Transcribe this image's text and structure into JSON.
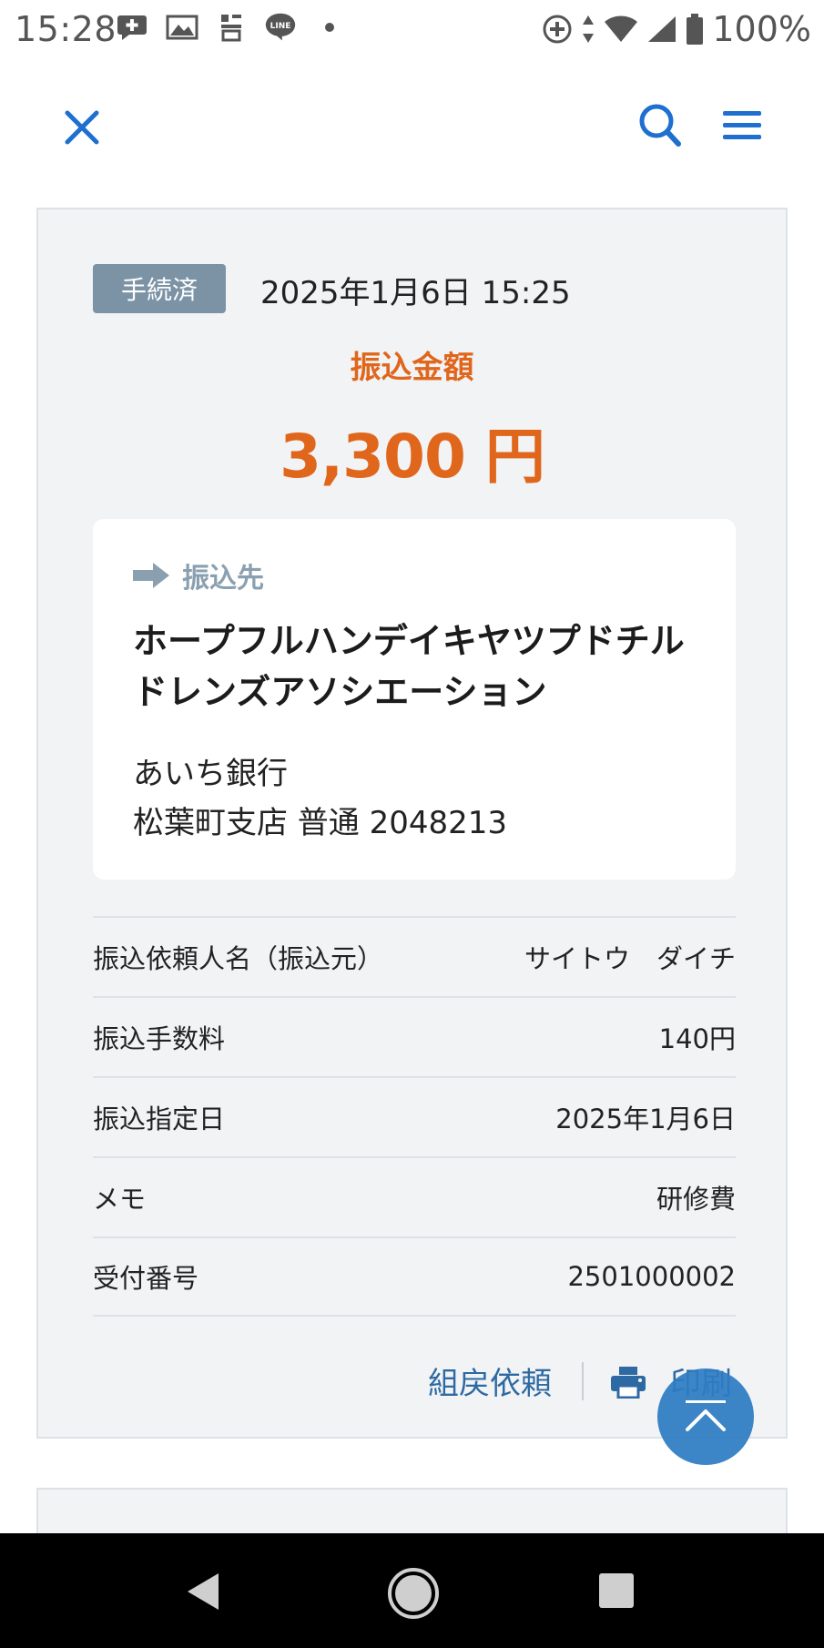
{
  "status_bar": {
    "time": "15:28",
    "battery": "100%",
    "left_icons": [
      "chat-plus-icon",
      "gallery-icon",
      "app-icon",
      "line-icon",
      "dot-icon"
    ],
    "right_icons": [
      "sync-icon",
      "data-arrows-icon",
      "wifi-icon",
      "signal-icon",
      "battery-icon"
    ]
  },
  "header": {
    "close_icon": "close-icon",
    "search_icon": "search-icon",
    "menu_icon": "menu-icon",
    "accent": "#1e6fd0"
  },
  "transfer": {
    "status": "手続済",
    "datetime": "2025年1月6日 15:25",
    "amount_label": "振込金額",
    "amount": "3,300 円",
    "payee_label": "振込先",
    "payee_name": "ホープフルハンデイキヤツプドチルドレンズアソシエーション",
    "bank_name": "あいち銀行",
    "branch_account": "松葉町支店 普通 2048213"
  },
  "details": [
    {
      "label": "振込依頼人名（振込元）",
      "value": "サイトウ　ダイチ"
    },
    {
      "label": "振込手数料",
      "value": "140円"
    },
    {
      "label": "振込指定日",
      "value": "2025年1月6日"
    },
    {
      "label": "メモ",
      "value": "研修費"
    },
    {
      "label": "受付番号",
      "value": "2501000002"
    }
  ],
  "actions": {
    "refund_request": "組戻依頼",
    "print": "印刷"
  },
  "colors": {
    "amount": "#e0661c",
    "badge": "#7c93a6",
    "link": "#2d6aa3",
    "fab": "#2e7cc3"
  }
}
